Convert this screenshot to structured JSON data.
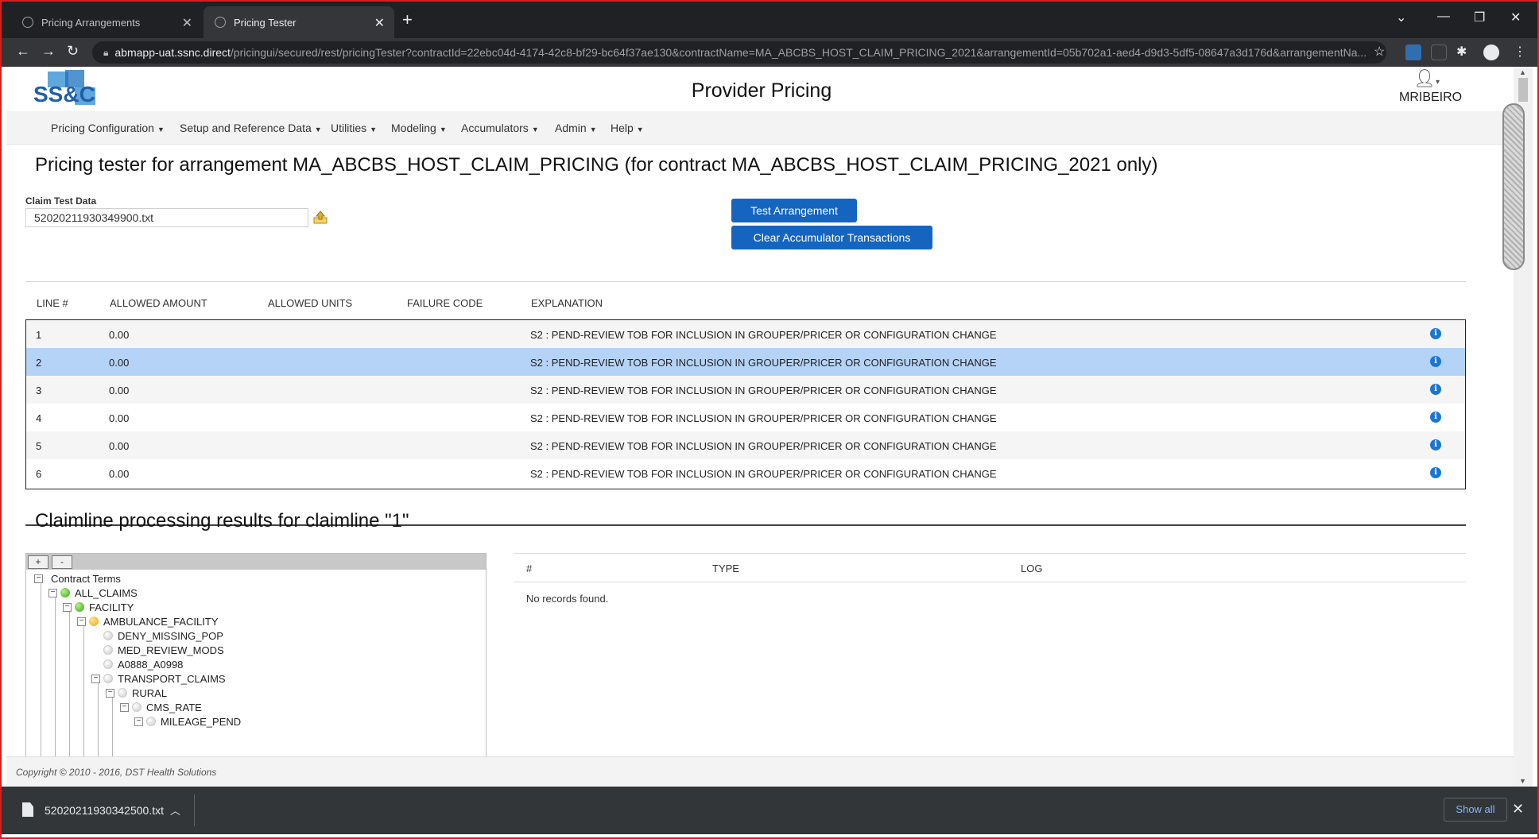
{
  "browser": {
    "tabs": [
      {
        "label": "Pricing Arrangements"
      },
      {
        "label": "Pricing Tester"
      }
    ],
    "url_host": "abmapp-uat.ssnc.direct",
    "url_path": "/pricingui/secured/rest/pricingTester?contractId=22ebc04d-4174-42c8-bf29-bc64f37ae130&contractName=MA_ABCBS_HOST_CLAIM_PRICING_2021&arrangementId=05b702a1-aed4-d9d3-5df5-08647a3d176d&arrangementNa..."
  },
  "header": {
    "logo_text": "SS&C",
    "title": "Provider Pricing",
    "user": "MRIBEIRO"
  },
  "menu": [
    {
      "label": "Pricing Configuration"
    },
    {
      "label": "Setup and Reference Data"
    },
    {
      "label": "Utilities"
    },
    {
      "label": "Modeling"
    },
    {
      "label": "Accumulators"
    },
    {
      "label": "Admin"
    },
    {
      "label": "Help"
    }
  ],
  "page": {
    "heading": "Pricing tester for arrangement MA_ABCBS_HOST_CLAIM_PRICING (for contract MA_ABCBS_HOST_CLAIM_PRICING_2021 only)",
    "claim_label": "Claim Test Data",
    "claim_value": "52020211930349900.txt",
    "btn_test": "Test Arrangement",
    "btn_clear": "Clear Accumulator Transactions"
  },
  "grid": {
    "columns": [
      "LINE #",
      "ALLOWED AMOUNT",
      "ALLOWED UNITS",
      "FAILURE CODE",
      "EXPLANATION"
    ],
    "rows": [
      {
        "line": "1",
        "amount": "0.00",
        "units": "",
        "failure": "",
        "explanation": "S2 : PEND-REVIEW TOB FOR INCLUSION IN GROUPER/PRICER OR CONFIGURATION CHANGE"
      },
      {
        "line": "2",
        "amount": "0.00",
        "units": "",
        "failure": "",
        "explanation": "S2 : PEND-REVIEW TOB FOR INCLUSION IN GROUPER/PRICER OR CONFIGURATION CHANGE"
      },
      {
        "line": "3",
        "amount": "0.00",
        "units": "",
        "failure": "",
        "explanation": "S2 : PEND-REVIEW TOB FOR INCLUSION IN GROUPER/PRICER OR CONFIGURATION CHANGE"
      },
      {
        "line": "4",
        "amount": "0.00",
        "units": "",
        "failure": "",
        "explanation": "S2 : PEND-REVIEW TOB FOR INCLUSION IN GROUPER/PRICER OR CONFIGURATION CHANGE"
      },
      {
        "line": "5",
        "amount": "0.00",
        "units": "",
        "failure": "",
        "explanation": "S2 : PEND-REVIEW TOB FOR INCLUSION IN GROUPER/PRICER OR CONFIGURATION CHANGE"
      },
      {
        "line": "6",
        "amount": "0.00",
        "units": "",
        "failure": "",
        "explanation": "S2 : PEND-REVIEW TOB FOR INCLUSION IN GROUPER/PRICER OR CONFIGURATION CHANGE"
      }
    ],
    "selected_line": "2"
  },
  "claimline": {
    "heading": "Claimline processing results for claimline \"1\"",
    "tree_expand": "+",
    "tree_collapse": "-",
    "tree": [
      {
        "label": "Contract Terms",
        "status": "none"
      },
      {
        "label": "ALL_CLAIMS",
        "status": "green"
      },
      {
        "label": "FACILITY",
        "status": "green"
      },
      {
        "label": "AMBULANCE_FACILITY",
        "status": "orange"
      },
      {
        "label": "DENY_MISSING_POP",
        "status": "grey"
      },
      {
        "label": "MED_REVIEW_MODS",
        "status": "grey"
      },
      {
        "label": "A0888_A0998",
        "status": "grey"
      },
      {
        "label": "TRANSPORT_CLAIMS",
        "status": "grey"
      },
      {
        "label": "RURAL",
        "status": "grey"
      },
      {
        "label": "CMS_RATE",
        "status": "grey"
      },
      {
        "label": "MILEAGE_PEND",
        "status": "grey"
      }
    ],
    "log_columns": [
      "#",
      "TYPE",
      "LOG"
    ],
    "no_records": "No records found."
  },
  "footer": {
    "copyright": "Copyright © 2010 - 2016, DST Health Solutions"
  },
  "download_bar": {
    "file_name": "52020211930342500.txt",
    "show_all": "Show all"
  },
  "colors": {
    "primary_button": "#1565c0",
    "selected_row": "#b5d3f7",
    "info_icon": "#1976d2"
  }
}
